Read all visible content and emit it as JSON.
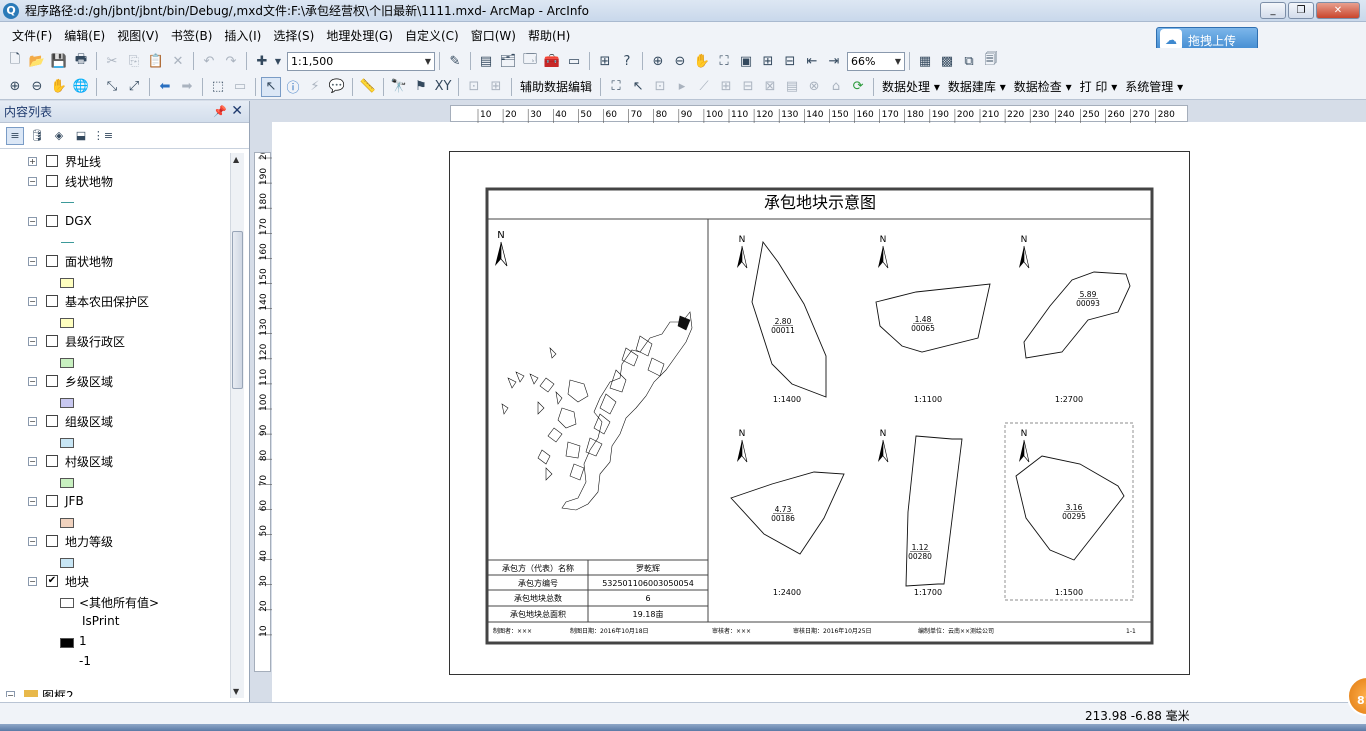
{
  "window": {
    "title": "程序路径:d:/gh/jbnt/jbnt/bin/Debug/,mxd文件:F:\\承包经营权\\个旧最新\\1111.mxd- ArcMap - ArcInfo"
  },
  "menubar": {
    "items": [
      "文件(F)",
      "编辑(E)",
      "视图(V)",
      "书签(B)",
      "插入(I)",
      "选择(S)",
      "地理处理(G)",
      "自定义(C)",
      "窗口(W)",
      "帮助(H)"
    ]
  },
  "upload_button": {
    "label": "拖拽上传"
  },
  "toolbar": {
    "scale": "1:1,500",
    "zoom": "66%",
    "aux_edit_label": "辅助数据编辑",
    "menus": [
      "数据处理",
      "数据建库",
      "数据检查",
      "打 印",
      "系统管理"
    ]
  },
  "toc": {
    "title": "内容列表",
    "layers": [
      {
        "name": "界址线",
        "checked": false,
        "expander": "+"
      },
      {
        "name": "线状地物",
        "checked": false,
        "expander": "−"
      },
      {
        "name": "DGX",
        "checked": false,
        "expander": "−"
      },
      {
        "name": "面状地物",
        "checked": false,
        "expander": "−"
      },
      {
        "name": "基本农田保护区",
        "checked": false,
        "expander": "−"
      },
      {
        "name": "县级行政区",
        "checked": false,
        "expander": "−"
      },
      {
        "name": "乡级区域",
        "checked": false,
        "expander": "−"
      },
      {
        "name": "组级区域",
        "checked": false,
        "expander": "−"
      },
      {
        "name": "村级区域",
        "checked": false,
        "expander": "−"
      },
      {
        "name": "JFB",
        "checked": false,
        "expander": "−"
      },
      {
        "name": "地力等级",
        "checked": false,
        "expander": "−"
      },
      {
        "name": "地块",
        "checked": true,
        "expander": "−"
      }
    ],
    "legend": {
      "all_other": "<其他所有值>",
      "field": "IsPrint",
      "value1": "1",
      "value2": "-1",
      "bottom_cut": "图框2"
    },
    "symbol_colors": {
      "line_teal": "#3c9a9a",
      "poly_cream": "#ffffc0",
      "poly_green": "#c8f0c0",
      "poly_lavender": "#c8c8f0",
      "poly_lightblue": "#c8e6f5",
      "poly_peach": "#f0d2be"
    }
  },
  "rulers": {
    "h_ticks": [
      "10",
      "20",
      "30",
      "40",
      "50",
      "60",
      "70",
      "80",
      "90",
      "100",
      "110",
      "120",
      "130",
      "140",
      "150",
      "160",
      "170",
      "180",
      "190",
      "200",
      "210",
      "220",
      "230",
      "240",
      "250",
      "260",
      "270",
      "280"
    ],
    "v_ticks": [
      "200",
      "190",
      "180",
      "170",
      "160",
      "150",
      "140",
      "130",
      "120",
      "110",
      "100",
      "90",
      "80",
      "70",
      "60",
      "50",
      "40",
      "30",
      "20",
      "10"
    ]
  },
  "layout": {
    "map_title": "承包地块示意图",
    "north": "N",
    "info_table": [
      {
        "label": "承包方（代表）名称",
        "value": "罗乾辉"
      },
      {
        "label": "承包方编号",
        "value": "532501106003050054"
      },
      {
        "label": "承包地块总数",
        "value": "6"
      },
      {
        "label": "承包地块总面积",
        "value": "19.18亩"
      }
    ],
    "parcels": [
      {
        "area": "2.80",
        "code": "00011",
        "scale": "1:1400"
      },
      {
        "area": "1.48",
        "code": "00065",
        "scale": "1:1100"
      },
      {
        "area": "5.89",
        "code": "00093",
        "scale": "1:2700"
      },
      {
        "area": "4.73",
        "code": "00186",
        "scale": "1:2400"
      },
      {
        "area": "1.12",
        "code": "00280",
        "scale": "1:1700"
      },
      {
        "area": "3.16",
        "code": "00295",
        "scale": "1:1500"
      }
    ],
    "footer": {
      "maker": "制图者：×××",
      "make_date": "制图日期：2016年10月18日",
      "checker": "审核者：×××",
      "check_date": "审核日期：2016年10月25日",
      "unit": "编制单位：云南××测绘公司",
      "page": "1-1"
    }
  },
  "status": {
    "coords": "213.98   -6.88 毫米"
  },
  "badge": {
    "text": "81"
  }
}
